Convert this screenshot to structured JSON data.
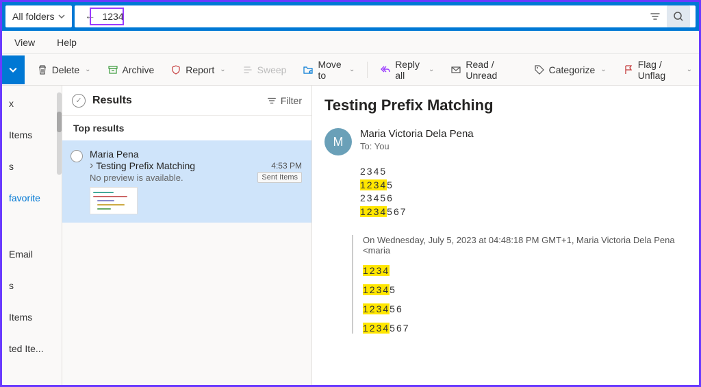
{
  "search": {
    "scope": "All folders",
    "value": "1234"
  },
  "menu": {
    "view": "View",
    "help": "Help"
  },
  "toolbar": {
    "delete": "Delete",
    "archive": "Archive",
    "report": "Report",
    "sweep": "Sweep",
    "moveTo": "Move to",
    "replyAll": "Reply all",
    "readUnread": "Read / Unread",
    "categorize": "Categorize",
    "flag": "Flag / Unflag"
  },
  "folders": [
    {
      "label": "x",
      "fav": false
    },
    {
      "label": "Items",
      "fav": false
    },
    {
      "label": "s",
      "fav": false
    },
    {
      "label": "favorite",
      "fav": true
    },
    {
      "label": "Email",
      "fav": false
    },
    {
      "label": "s",
      "fav": false
    },
    {
      "label": "Items",
      "fav": false
    },
    {
      "label": "ted Ite...",
      "fav": false
    }
  ],
  "list": {
    "title": "Results",
    "filter": "Filter",
    "section": "Top results",
    "msg": {
      "sender": "Maria Pena",
      "subject": "Testing Prefix Matching",
      "time": "4:53 PM",
      "preview": "No preview is available.",
      "folder": "Sent Items"
    }
  },
  "reading": {
    "subject": "Testing Prefix Matching",
    "avatar": "M",
    "fromName": "Maria Victoria Dela Pena",
    "toLine": "To:  You",
    "body": [
      {
        "pre": "",
        "hl": "",
        "post": "2345"
      },
      {
        "pre": "",
        "hl": "1234",
        "post": "5"
      },
      {
        "pre": "",
        "hl": "",
        "post": "23456"
      },
      {
        "pre": "",
        "hl": "1234",
        "post": "567"
      }
    ],
    "replyMeta": "On Wednesday, July 5, 2023 at 04:48:18 PM GMT+1, Maria Victoria Dela Pena <maria",
    "replyBody": [
      {
        "hl": "1234",
        "post": ""
      },
      {
        "hl": "1234",
        "post": "5"
      },
      {
        "hl": "1234",
        "post": "56"
      },
      {
        "hl": "1234",
        "post": "567"
      }
    ]
  }
}
